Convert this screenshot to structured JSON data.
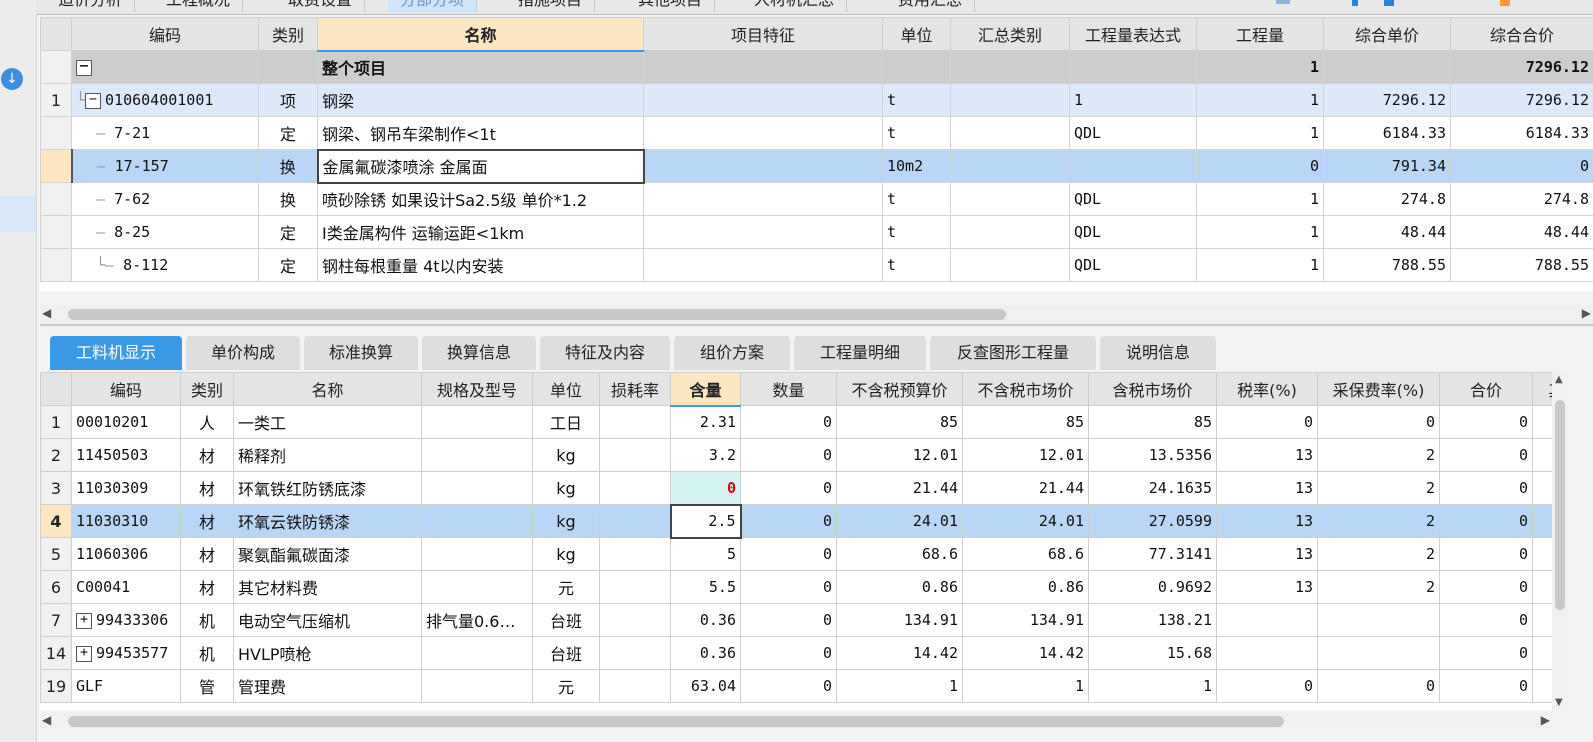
{
  "top_tabs": [
    "造价分析",
    "工程概况",
    "取费设置",
    "分部分项",
    "措施项目",
    "其他项目",
    "人材机汇总",
    "费用汇总"
  ],
  "upper": {
    "headers": [
      "编码",
      "类别",
      "名称",
      "项目特征",
      "单位",
      "汇总类别",
      "工程量表达式",
      "工程量",
      "综合单价",
      "综合合价"
    ],
    "group": {
      "name": "整个项目",
      "qty": "1",
      "total": "7296.12"
    },
    "rows": [
      {
        "num": "1",
        "code": "010604001001",
        "type": "项",
        "name": "钢梁",
        "unit": "t",
        "expr": "1",
        "qty": "1",
        "price": "7296.12",
        "total": "7296.12"
      },
      {
        "num": "",
        "code": "7-21",
        "type": "定",
        "name": "钢梁、钢吊车梁制作<1t",
        "unit": "t",
        "expr": "QDL",
        "qty": "1",
        "price": "6184.33",
        "total": "6184.33"
      },
      {
        "num": "",
        "code": "17-157",
        "type": "换",
        "name": "金属氟碳漆喷涂 金属面",
        "unit": "10m2",
        "expr": "",
        "qty": "0",
        "price": "791.34",
        "total": "0"
      },
      {
        "num": "",
        "code": "7-62",
        "type": "换",
        "name": "喷砂除锈  如果设计Sa2.5级 单价*1.2",
        "unit": "t",
        "expr": "QDL",
        "qty": "1",
        "price": "274.8",
        "total": "274.8"
      },
      {
        "num": "",
        "code": "8-25",
        "type": "定",
        "name": "Ⅰ类金属构件 运输运距<1km",
        "unit": "t",
        "expr": "QDL",
        "qty": "1",
        "price": "48.44",
        "total": "48.44"
      },
      {
        "num": "",
        "code": "8-112",
        "type": "定",
        "name": "钢柱每根重量 4t以内安装",
        "unit": "t",
        "expr": "QDL",
        "qty": "1",
        "price": "788.55",
        "total": "788.55"
      }
    ]
  },
  "lower_tabs": [
    "工料机显示",
    "单价构成",
    "标准换算",
    "换算信息",
    "特征及内容",
    "组价方案",
    "工程量明细",
    "反查图形工程量",
    "说明信息"
  ],
  "lower": {
    "headers": [
      "编码",
      "类别",
      "名称",
      "规格及型号",
      "单位",
      "损耗率",
      "含量",
      "数量",
      "不含税预算价",
      "不含税市场价",
      "含税市场价",
      "税率(%)",
      "采保费率(%)",
      "合价"
    ],
    "rows": [
      {
        "num": "1",
        "code": "00010201",
        "type": "人",
        "name": "一类工",
        "spec": "",
        "unit": "工日",
        "content": "2.31",
        "qty": "0",
        "p1": "85",
        "p2": "85",
        "p3": "85",
        "tax": "0",
        "fee": "0",
        "sum": "0"
      },
      {
        "num": "2",
        "code": "11450503",
        "type": "材",
        "name": "稀释剂",
        "spec": "",
        "unit": "kg",
        "content": "3.2",
        "qty": "0",
        "p1": "12.01",
        "p2": "12.01",
        "p3": "13.5356",
        "tax": "13",
        "fee": "2",
        "sum": "0"
      },
      {
        "num": "3",
        "code": "11030309",
        "type": "材",
        "name": "环氧铁红防锈底漆",
        "spec": "",
        "unit": "kg",
        "content": "0",
        "qty": "0",
        "p1": "21.44",
        "p2": "21.44",
        "p3": "24.1635",
        "tax": "13",
        "fee": "2",
        "sum": "0"
      },
      {
        "num": "4",
        "code": "11030310",
        "type": "材",
        "name": "环氧云铁防锈漆",
        "spec": "",
        "unit": "kg",
        "content": "2.5",
        "qty": "0",
        "p1": "24.01",
        "p2": "24.01",
        "p3": "27.0599",
        "tax": "13",
        "fee": "2",
        "sum": "0"
      },
      {
        "num": "5",
        "code": "11060306",
        "type": "材",
        "name": "聚氨酯氟碳面漆",
        "spec": "",
        "unit": "kg",
        "content": "5",
        "qty": "0",
        "p1": "68.6",
        "p2": "68.6",
        "p3": "77.3141",
        "tax": "13",
        "fee": "2",
        "sum": "0"
      },
      {
        "num": "6",
        "code": "C00041",
        "type": "材",
        "name": "其它材料费",
        "spec": "",
        "unit": "元",
        "content": "5.5",
        "qty": "0",
        "p1": "0.86",
        "p2": "0.86",
        "p3": "0.9692",
        "tax": "13",
        "fee": "2",
        "sum": "0"
      },
      {
        "num": "7",
        "code": "99433306",
        "type": "机",
        "name": "电动空气压缩机",
        "spec": "排气量0.6…",
        "unit": "台班",
        "content": "0.36",
        "qty": "0",
        "p1": "134.91",
        "p2": "134.91",
        "p3": "138.21",
        "tax": "",
        "fee": "",
        "sum": "0"
      },
      {
        "num": "14",
        "code": "99453577",
        "type": "机",
        "name": "HVLP喷枪",
        "spec": "",
        "unit": "台班",
        "content": "0.36",
        "qty": "0",
        "p1": "14.42",
        "p2": "14.42",
        "p3": "15.68",
        "tax": "",
        "fee": "",
        "sum": "0"
      },
      {
        "num": "19",
        "code": "GLF",
        "type": "管",
        "name": "管理费",
        "spec": "",
        "unit": "元",
        "content": "63.04",
        "qty": "0",
        "p1": "1",
        "p2": "1",
        "p3": "1",
        "tax": "0",
        "fee": "0",
        "sum": "0"
      }
    ]
  },
  "colors": {
    "accent": "#3b9ae8",
    "selected_row": "#b9d6f6",
    "highlight_row": "#dde9fb",
    "group_row": "#cdcdcd",
    "header_active": "#fde7c0",
    "zero_value_red": "#e00000"
  }
}
